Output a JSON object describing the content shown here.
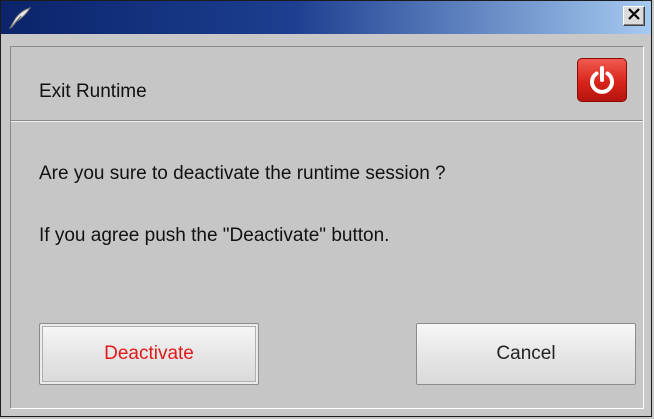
{
  "window": {
    "close_glyph": "✕",
    "app_icon": "feather-pen-icon"
  },
  "dialog": {
    "header": "Exit Runtime",
    "header_icon": "power-icon",
    "accent_color": "#d8241b",
    "message_line1": "Are you sure to deactivate the runtime session ?",
    "message_line2": "If you agree push the \"Deactivate\" button."
  },
  "buttons": {
    "deactivate_label": "Deactivate",
    "deactivate_color": "#e01a1a",
    "cancel_label": "Cancel"
  }
}
